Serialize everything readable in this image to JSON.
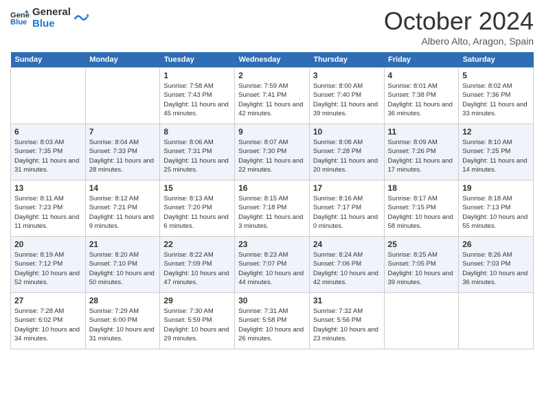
{
  "logo": {
    "line1": "General",
    "line2": "Blue"
  },
  "title": "October 2024",
  "location": "Albero Alto, Aragon, Spain",
  "days_of_week": [
    "Sunday",
    "Monday",
    "Tuesday",
    "Wednesday",
    "Thursday",
    "Friday",
    "Saturday"
  ],
  "weeks": [
    [
      {
        "num": "",
        "info": ""
      },
      {
        "num": "",
        "info": ""
      },
      {
        "num": "1",
        "info": "Sunrise: 7:58 AM\nSunset: 7:43 PM\nDaylight: 11 hours and 45 minutes."
      },
      {
        "num": "2",
        "info": "Sunrise: 7:59 AM\nSunset: 7:41 PM\nDaylight: 11 hours and 42 minutes."
      },
      {
        "num": "3",
        "info": "Sunrise: 8:00 AM\nSunset: 7:40 PM\nDaylight: 11 hours and 39 minutes."
      },
      {
        "num": "4",
        "info": "Sunrise: 8:01 AM\nSunset: 7:38 PM\nDaylight: 11 hours and 36 minutes."
      },
      {
        "num": "5",
        "info": "Sunrise: 8:02 AM\nSunset: 7:36 PM\nDaylight: 11 hours and 33 minutes."
      }
    ],
    [
      {
        "num": "6",
        "info": "Sunrise: 8:03 AM\nSunset: 7:35 PM\nDaylight: 11 hours and 31 minutes."
      },
      {
        "num": "7",
        "info": "Sunrise: 8:04 AM\nSunset: 7:33 PM\nDaylight: 11 hours and 28 minutes."
      },
      {
        "num": "8",
        "info": "Sunrise: 8:06 AM\nSunset: 7:31 PM\nDaylight: 11 hours and 25 minutes."
      },
      {
        "num": "9",
        "info": "Sunrise: 8:07 AM\nSunset: 7:30 PM\nDaylight: 11 hours and 22 minutes."
      },
      {
        "num": "10",
        "info": "Sunrise: 8:08 AM\nSunset: 7:28 PM\nDaylight: 11 hours and 20 minutes."
      },
      {
        "num": "11",
        "info": "Sunrise: 8:09 AM\nSunset: 7:26 PM\nDaylight: 11 hours and 17 minutes."
      },
      {
        "num": "12",
        "info": "Sunrise: 8:10 AM\nSunset: 7:25 PM\nDaylight: 11 hours and 14 minutes."
      }
    ],
    [
      {
        "num": "13",
        "info": "Sunrise: 8:11 AM\nSunset: 7:23 PM\nDaylight: 11 hours and 11 minutes."
      },
      {
        "num": "14",
        "info": "Sunrise: 8:12 AM\nSunset: 7:21 PM\nDaylight: 11 hours and 9 minutes."
      },
      {
        "num": "15",
        "info": "Sunrise: 8:13 AM\nSunset: 7:20 PM\nDaylight: 11 hours and 6 minutes."
      },
      {
        "num": "16",
        "info": "Sunrise: 8:15 AM\nSunset: 7:18 PM\nDaylight: 11 hours and 3 minutes."
      },
      {
        "num": "17",
        "info": "Sunrise: 8:16 AM\nSunset: 7:17 PM\nDaylight: 11 hours and 0 minutes."
      },
      {
        "num": "18",
        "info": "Sunrise: 8:17 AM\nSunset: 7:15 PM\nDaylight: 10 hours and 58 minutes."
      },
      {
        "num": "19",
        "info": "Sunrise: 8:18 AM\nSunset: 7:13 PM\nDaylight: 10 hours and 55 minutes."
      }
    ],
    [
      {
        "num": "20",
        "info": "Sunrise: 8:19 AM\nSunset: 7:12 PM\nDaylight: 10 hours and 52 minutes."
      },
      {
        "num": "21",
        "info": "Sunrise: 8:20 AM\nSunset: 7:10 PM\nDaylight: 10 hours and 50 minutes."
      },
      {
        "num": "22",
        "info": "Sunrise: 8:22 AM\nSunset: 7:09 PM\nDaylight: 10 hours and 47 minutes."
      },
      {
        "num": "23",
        "info": "Sunrise: 8:23 AM\nSunset: 7:07 PM\nDaylight: 10 hours and 44 minutes."
      },
      {
        "num": "24",
        "info": "Sunrise: 8:24 AM\nSunset: 7:06 PM\nDaylight: 10 hours and 42 minutes."
      },
      {
        "num": "25",
        "info": "Sunrise: 8:25 AM\nSunset: 7:05 PM\nDaylight: 10 hours and 39 minutes."
      },
      {
        "num": "26",
        "info": "Sunrise: 8:26 AM\nSunset: 7:03 PM\nDaylight: 10 hours and 36 minutes."
      }
    ],
    [
      {
        "num": "27",
        "info": "Sunrise: 7:28 AM\nSunset: 6:02 PM\nDaylight: 10 hours and 34 minutes."
      },
      {
        "num": "28",
        "info": "Sunrise: 7:29 AM\nSunset: 6:00 PM\nDaylight: 10 hours and 31 minutes."
      },
      {
        "num": "29",
        "info": "Sunrise: 7:30 AM\nSunset: 5:59 PM\nDaylight: 10 hours and 29 minutes."
      },
      {
        "num": "30",
        "info": "Sunrise: 7:31 AM\nSunset: 5:58 PM\nDaylight: 10 hours and 26 minutes."
      },
      {
        "num": "31",
        "info": "Sunrise: 7:32 AM\nSunset: 5:56 PM\nDaylight: 10 hours and 23 minutes."
      },
      {
        "num": "",
        "info": ""
      },
      {
        "num": "",
        "info": ""
      }
    ]
  ],
  "colors": {
    "header_bg": "#2f6db5",
    "header_text": "#ffffff",
    "row_odd": "#ffffff",
    "row_even": "#eef2f8"
  }
}
